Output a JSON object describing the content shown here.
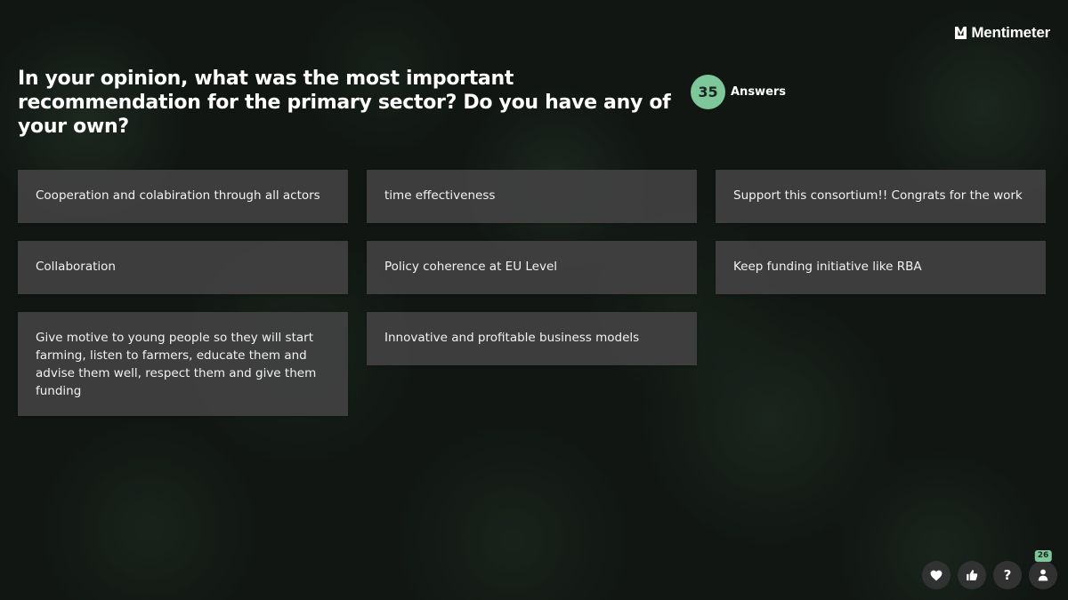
{
  "brand": {
    "name": "Mentimeter",
    "logo_icon": "mentimeter-logo-icon"
  },
  "question": {
    "title": "In your opinion, what was the most important recommendation for the primary sector? Do you have any of your own?"
  },
  "answers": {
    "count": "35",
    "label": "Answers",
    "badge_color": "#7dc79a"
  },
  "responses": [
    [
      "Cooperation and colabiration through all actors",
      "time effectiveness",
      "Support this consortium!! Congrats for the work"
    ],
    [
      "Collaboration",
      "Policy coherence at EU Level",
      "Keep funding initiative like RBA"
    ],
    [
      "Give motive to young people so they will start farming, listen to farmers, educate them and advise them well, respect them and give them funding",
      "Innovative and profitable business models"
    ]
  ],
  "controls": {
    "items": [
      "heart-icon",
      "thumbs-up-icon",
      "question-icon",
      "participant-icon"
    ],
    "question_glyph": "?",
    "participants": "26"
  }
}
